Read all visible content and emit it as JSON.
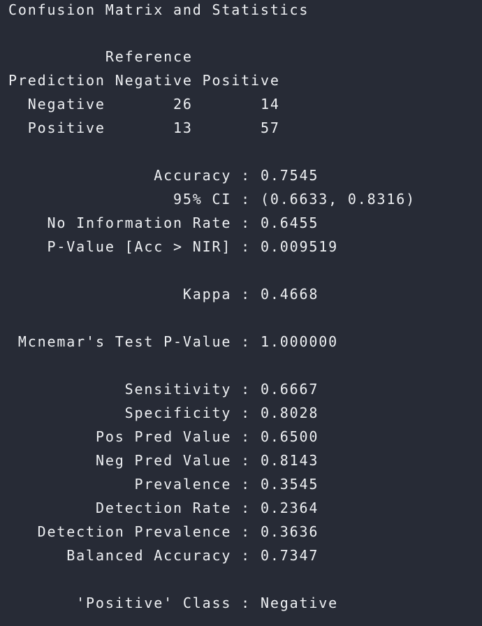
{
  "console": {
    "title": "Confusion Matrix and Statistics",
    "matrix": {
      "reference_label": "Reference",
      "prediction_label": "Prediction",
      "columns": [
        "Negative",
        "Positive"
      ],
      "rows": [
        {
          "label": "Negative",
          "values": [
            "26",
            "14"
          ]
        },
        {
          "label": "Positive",
          "values": [
            "13",
            "57"
          ]
        }
      ]
    },
    "stats": {
      "accuracy": {
        "label": "Accuracy",
        "value": "0.7545"
      },
      "ci": {
        "label": "95% CI",
        "value": "(0.6633, 0.8316)"
      },
      "nir": {
        "label": "No Information Rate",
        "value": "0.6455"
      },
      "pvalue": {
        "label": "P-Value [Acc > NIR]",
        "value": "0.009519"
      },
      "kappa": {
        "label": "Kappa",
        "value": "0.4668"
      },
      "mcnemar": {
        "label": "Mcnemar's Test P-Value",
        "value": "1.000000"
      },
      "sensitivity": {
        "label": "Sensitivity",
        "value": "0.6667"
      },
      "specificity": {
        "label": "Specificity",
        "value": "0.8028"
      },
      "ppv": {
        "label": "Pos Pred Value",
        "value": "0.6500"
      },
      "npv": {
        "label": "Neg Pred Value",
        "value": "0.8143"
      },
      "prevalence": {
        "label": "Prevalence",
        "value": "0.3545"
      },
      "detection_rate": {
        "label": "Detection Rate",
        "value": "0.2364"
      },
      "detection_prevalence": {
        "label": "Detection Prevalence",
        "value": "0.3636"
      },
      "balanced_accuracy": {
        "label": "Balanced Accuracy",
        "value": "0.7347"
      },
      "positive_class": {
        "label": "'Positive' Class",
        "value": "Negative"
      }
    },
    "separator": ":"
  }
}
